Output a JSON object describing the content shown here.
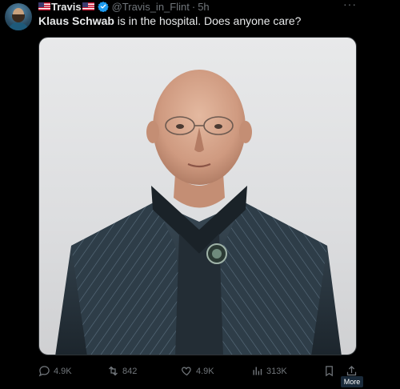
{
  "author": {
    "display_name": "Travis",
    "handle": "@Travis_in_Flint",
    "separator": "·",
    "time": "5h",
    "more_menu": "···"
  },
  "tweet": {
    "text_bold": "Klaus Schwab",
    "text_rest": " is in the hospital.  Does anyone care?"
  },
  "actions": {
    "replies": "4.9K",
    "reposts": "842",
    "likes": "4.9K",
    "views": "313K"
  },
  "tooltip": {
    "more": "More"
  },
  "icons": {
    "flag": "us-flag-icon",
    "verified": "verified-badge-icon",
    "reply": "reply-icon",
    "repost": "repost-icon",
    "like": "heart-icon",
    "views": "views-chart-icon",
    "bookmark": "bookmark-icon",
    "share": "share-icon"
  },
  "colors": {
    "background": "#000000",
    "text": "#e7e9ea",
    "muted": "#71767b",
    "verified": "#1d9bf0"
  }
}
